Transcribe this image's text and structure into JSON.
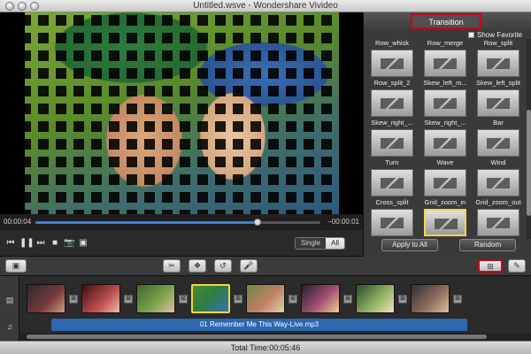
{
  "window": {
    "title": "Untitled.wsve - Wondershare Vivideo"
  },
  "preview": {
    "time_current": "00:00:04",
    "time_remaining": "−00:00:01",
    "progress": 0.78,
    "view_modes": [
      "Single",
      "All"
    ],
    "active_view_mode": "All"
  },
  "transition_panel": {
    "title": "Transition",
    "show_favorite_label": "Show Favorite",
    "items": [
      {
        "label": "Row_whisk"
      },
      {
        "label": "Row_merge"
      },
      {
        "label": "Row_split"
      },
      {
        "label": "Row_split_2"
      },
      {
        "label": "Skew_left_m..."
      },
      {
        "label": "Skew_left_split"
      },
      {
        "label": "Skew_right_..."
      },
      {
        "label": "Skew_right_..."
      },
      {
        "label": "Bar"
      },
      {
        "label": "Turn"
      },
      {
        "label": "Wave"
      },
      {
        "label": "Wind"
      },
      {
        "label": "Cross_split"
      },
      {
        "label": "Grid_zoom_in"
      },
      {
        "label": "Grid_zoom_out"
      }
    ],
    "selected_item": "Grid_zoom_in",
    "apply_all_label": "Apply to All",
    "random_label": "Random"
  },
  "timeline": {
    "audio_track_label": "01 Remember Me This Way-Live.mp3"
  },
  "status": {
    "total_time": "Total Time:00:05:46"
  },
  "colors": {
    "highlight": "#c8001c",
    "selection": "#f2d54a",
    "audio_track": "#2c67b0",
    "progress": "#3b7fd8"
  }
}
